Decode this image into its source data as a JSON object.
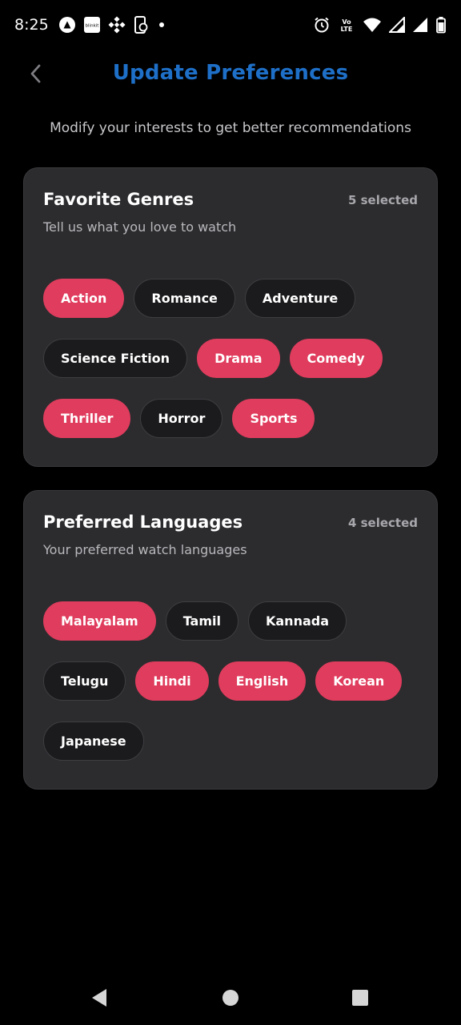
{
  "status_bar": {
    "time": "8:25",
    "left_icons": [
      "app-a-icon",
      "blinkit-icon",
      "binance-icon",
      "phone-sync-icon",
      "dot-icon"
    ],
    "blinkit_text": "blinkit",
    "volte_text": "Vo LTE",
    "right_icons": [
      "alarm-icon",
      "volte-icon",
      "wifi-icon",
      "signal-icon",
      "signal-icon",
      "battery-icon"
    ]
  },
  "header": {
    "title": "Update Preferences",
    "subtitle": "Modify your interests to get better recommendations"
  },
  "genres": {
    "title": "Favorite Genres",
    "count": "5 selected",
    "description": "Tell us what you love to watch",
    "items": [
      {
        "label": "Action",
        "selected": true
      },
      {
        "label": "Romance",
        "selected": false
      },
      {
        "label": "Adventure",
        "selected": false
      },
      {
        "label": "Science Fiction",
        "selected": false
      },
      {
        "label": "Drama",
        "selected": true
      },
      {
        "label": "Comedy",
        "selected": true
      },
      {
        "label": "Thriller",
        "selected": true
      },
      {
        "label": "Horror",
        "selected": false
      },
      {
        "label": "Sports",
        "selected": true
      }
    ]
  },
  "languages": {
    "title": "Preferred Languages",
    "count": "4 selected",
    "description": "Your preferred watch languages",
    "items": [
      {
        "label": "Malayalam",
        "selected": true
      },
      {
        "label": "Tamil",
        "selected": false
      },
      {
        "label": "Kannada",
        "selected": false
      },
      {
        "label": "Telugu",
        "selected": false
      },
      {
        "label": "Hindi",
        "selected": true
      },
      {
        "label": "English",
        "selected": true
      },
      {
        "label": "Korean",
        "selected": true
      },
      {
        "label": "Japanese",
        "selected": false
      }
    ]
  },
  "colors": {
    "title_blue": "#1e6fc7",
    "chip_selected": "#e03c5d",
    "chip_unselected": "#1b1b1d",
    "card_bg": "#2c2c2f",
    "background": "#000000"
  },
  "nav_bar": {
    "icons": [
      "back-triangle-icon",
      "home-circle-icon",
      "recents-square-icon"
    ]
  }
}
